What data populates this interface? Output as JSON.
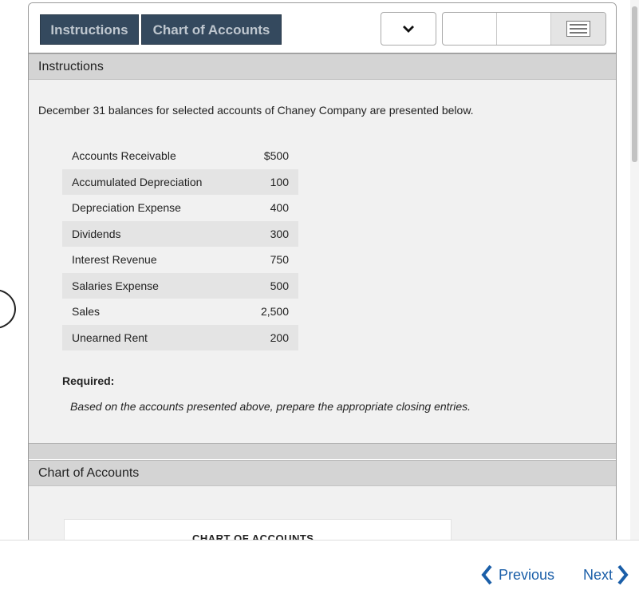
{
  "toolbar": {
    "tabs": [
      {
        "label": "Instructions"
      },
      {
        "label": "Chart of Accounts"
      }
    ]
  },
  "instructions_section": {
    "title": "Instructions",
    "intro": "December 31 balances for selected accounts of Chaney Company are presented below.",
    "accounts": [
      {
        "name": "Accounts Receivable",
        "amount": "$500"
      },
      {
        "name": "Accumulated Depreciation",
        "amount": "100"
      },
      {
        "name": "Depreciation Expense",
        "amount": "400"
      },
      {
        "name": "Dividends",
        "amount": "300"
      },
      {
        "name": "Interest Revenue",
        "amount": "750"
      },
      {
        "name": "Salaries Expense",
        "amount": "500"
      },
      {
        "name": "Sales",
        "amount": "2,500"
      },
      {
        "name": "Unearned Rent",
        "amount": "200"
      }
    ],
    "required_label": "Required:",
    "required_text": "Based on the accounts presented above, prepare the appropriate closing entries."
  },
  "chart_section": {
    "title": "Chart of Accounts",
    "table_title": "CHART OF ACCOUNTS"
  },
  "footer": {
    "previous_label": "Previous",
    "next_label": "Next"
  },
  "colors": {
    "tab_bg": "#34495e",
    "tab_text": "#bfc7cf",
    "link": "#1a5ea8",
    "section_header": "#d4d4d4",
    "section_body": "#f1f1f1"
  }
}
